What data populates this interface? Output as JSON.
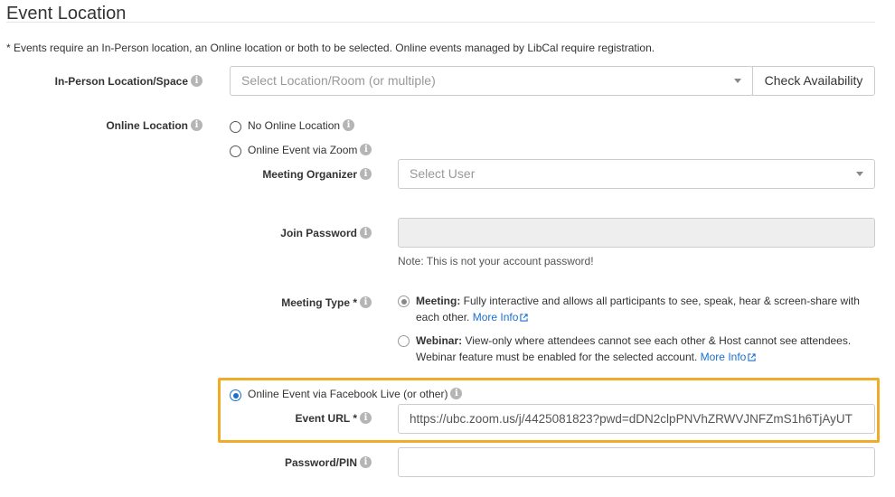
{
  "section_title": "Event Location",
  "requirement_note": "* Events require an In-Person location, an Online location or both to be selected. Online events managed by LibCal require registration.",
  "in_person": {
    "label": "In-Person Location/Space",
    "placeholder": "Select Location/Room (or multiple)",
    "check_button": "Check Availability"
  },
  "online": {
    "label": "Online Location",
    "options": {
      "none": "No Online Location",
      "zoom": "Online Event via Zoom",
      "facebook": "Online Event via Facebook Live (or other)"
    },
    "selected": "facebook"
  },
  "zoom": {
    "organizer_label": "Meeting Organizer",
    "organizer_placeholder": "Select User",
    "join_password_label": "Join Password",
    "join_password_help": "Note: This is not your account password!",
    "meeting_type_label": "Meeting Type *",
    "meeting_type_selected": "meeting",
    "meeting": {
      "title": "Meeting:",
      "desc": " Fully interactive and allows all participants to see, speak, hear & screen-share with each other. ",
      "more": "More Info"
    },
    "webinar": {
      "title": "Webinar:",
      "desc": " View-only where attendees cannot see each other & Host cannot see attendees. Webinar feature must be enabled for the selected account. ",
      "more": "More Info"
    }
  },
  "facebook": {
    "event_url_label": "Event URL *",
    "event_url_value": "https://ubc.zoom.us/j/4425081823?pwd=dDN2clpPNVhZRWVJNFZmS1h6TjAyUT",
    "password_label": "Password/PIN",
    "password_value": ""
  },
  "colors": {
    "highlight": "#f0ac28",
    "link": "#1a6fd1",
    "radio_selected": "#1a6fd1"
  },
  "icons": {
    "info": "info-circle-icon",
    "caret": "caret-down-icon",
    "external": "external-link-icon"
  }
}
